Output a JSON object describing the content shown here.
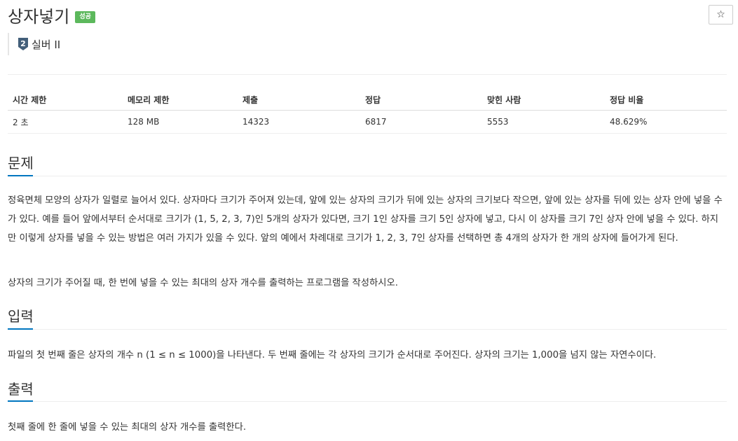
{
  "problem": {
    "title": "상자넣기",
    "status_badge": "성공",
    "star_symbol": "☆",
    "tier": {
      "level": "2",
      "label": "실버 II",
      "color": "#435f7a"
    }
  },
  "info_table": {
    "headers": [
      "시간 제한",
      "메모리 제한",
      "제출",
      "정답",
      "맞힌 사람",
      "정답 비율"
    ],
    "values": [
      "2 초",
      "128 MB",
      "14323",
      "6817",
      "5553",
      "48.629%"
    ]
  },
  "sections": {
    "description": {
      "heading": "문제",
      "paragraphs": [
        "정육면체 모양의 상자가 일렬로 늘어서 있다. 상자마다 크기가 주어져 있는데, 앞에 있는 상자의 크기가 뒤에 있는 상자의 크기보다 작으면, 앞에 있는 상자를 뒤에 있는 상자 안에 넣을 수가 있다. 예를 들어 앞에서부터 순서대로 크기가 (1, 5, 2, 3, 7)인 5개의 상자가 있다면, 크기 1인 상자를 크기 5인 상자에 넣고, 다시 이 상자를 크기 7인 상자 안에 넣을 수 있다. 하지만 이렇게 상자를 넣을 수 있는 방법은 여러 가지가 있을 수 있다. 앞의 예에서 차례대로 크기가 1, 2, 3, 7인 상자를 선택하면 총 4개의 상자가 한 개의 상자에 들어가게 된다.",
        "상자의 크기가 주어질 때, 한 번에 넣을 수 있는 최대의 상자 개수를 출력하는 프로그램을 작성하시오."
      ]
    },
    "input": {
      "heading": "입력",
      "text": "파일의 첫 번째 줄은 상자의 개수 n (1 ≤ n ≤ 1000)을 나타낸다. 두 번째 줄에는 각 상자의 크기가 순서대로 주어진다. 상자의 크기는 1,000을 넘지 않는 자연수이다."
    },
    "output": {
      "heading": "출력",
      "text": "첫째 줄에 한 줄에 넣을 수 있는 최대의 상자 개수를 출력한다."
    }
  },
  "colors": {
    "badge_success": "#5cb85c",
    "section_accent": "#0076c0",
    "text": "#333333"
  }
}
